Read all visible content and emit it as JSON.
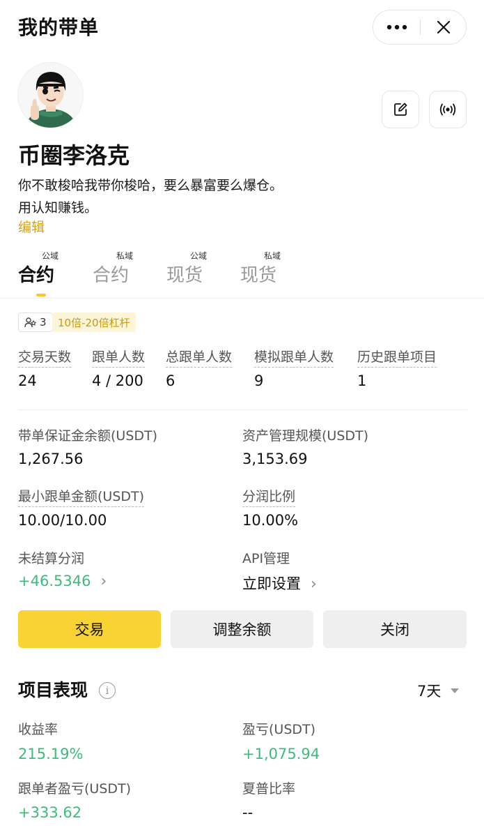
{
  "header": {
    "title": "我的带单",
    "more_icon": "more-dots-icon",
    "close_icon": "close-icon"
  },
  "profile": {
    "nickname": "币圈李洛克",
    "bio_line1": "你不敢梭哈我带你梭哈，要么暴富要么爆仓。",
    "bio_line2": "用认知赚钱。",
    "edit_link": "编辑",
    "edit_icon": "edit-icon",
    "broadcast_icon": "broadcast-icon"
  },
  "tabs": [
    {
      "tag": "公域",
      "label": "合约",
      "active": true
    },
    {
      "tag": "私域",
      "label": "合约",
      "active": false
    },
    {
      "tag": "公域",
      "label": "现货",
      "active": false
    },
    {
      "tag": "私域",
      "label": "现货",
      "active": false
    }
  ],
  "chips": {
    "follower_count": "3",
    "leverage": "10倍-20倍杠杆"
  },
  "stats": [
    {
      "label": "交易天数",
      "value": "24"
    },
    {
      "label": "跟单人数",
      "value": "4 / 200"
    },
    {
      "label": "总跟单人数",
      "value": "6"
    },
    {
      "label": "模拟跟单人数",
      "value": "9"
    },
    {
      "label": "历史跟单项目",
      "value": "1"
    }
  ],
  "details": {
    "margin_balance_label": "带单保证金余额(USDT)",
    "margin_balance_value": "1,267.56",
    "aum_label": "资产管理规模(USDT)",
    "aum_value": "3,153.69",
    "min_copy_label": "最小跟单金额(USDT)",
    "min_copy_value": "10.00/10.00",
    "profit_share_label": "分润比例",
    "profit_share_value": "10.00%",
    "unsettled_label": "未结算分润",
    "unsettled_value": "+46.5346",
    "api_label": "API管理",
    "api_value": "立即设置"
  },
  "actions": {
    "trade": "交易",
    "adjust_balance": "调整余额",
    "close": "关闭"
  },
  "performance": {
    "title": "项目表现",
    "info_glyph": "i",
    "period": "7天",
    "roi_label": "收益率",
    "roi_value": "215.19%",
    "pnl_label": "盈亏(USDT)",
    "pnl_value": "+1,075.94",
    "follower_pnl_label": "跟单者盈亏(USDT)",
    "follower_pnl_value": "+333.62",
    "sharpe_label": "夏普比率",
    "sharpe_value": "--"
  },
  "colors": {
    "accent_yellow": "#f9d233",
    "profit_green": "#3dbb7a",
    "link_gold": "#d4a21a"
  }
}
